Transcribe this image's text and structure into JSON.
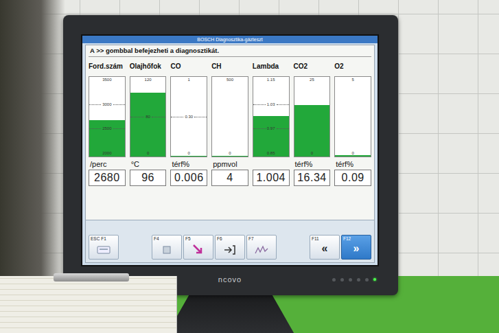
{
  "monitor": {
    "brand": "ncovo",
    "power_on": true
  },
  "screen": {
    "title": "BOSCH Diagnosztika-gázteszt",
    "message": "A >> gombbal befejezheti a diagnosztikát."
  },
  "gauges": [
    {
      "label": "Ford.szám",
      "ticks": [
        "3500",
        "3000",
        "2500",
        "2000"
      ],
      "level": 0.46,
      "unit": "/perc",
      "reading": "2680"
    },
    {
      "label": "Olajhőfok",
      "ticks": [
        "120",
        "80",
        "0"
      ],
      "level": 0.8,
      "unit": "°C",
      "reading": "96"
    },
    {
      "label": "CO",
      "ticks": [
        "1",
        "0.30",
        "0"
      ],
      "level": 0.006,
      "unit": "térf%",
      "reading": "0.006"
    },
    {
      "label": "CH",
      "ticks": [
        "500",
        "0"
      ],
      "level": 0.008,
      "unit": "ppmvol",
      "reading": "4"
    },
    {
      "label": "Lambda",
      "ticks": [
        "1.15",
        "1.03",
        "0.97",
        "0.85"
      ],
      "level": 0.51,
      "reading": "1.004"
    },
    {
      "label": "CO2",
      "ticks": [
        "25",
        "0"
      ],
      "level": 0.65,
      "unit": "térf%",
      "reading": "16.34"
    },
    {
      "label": "O2",
      "ticks": [
        "5",
        "0"
      ],
      "level": 0.018,
      "unit": "térf%",
      "reading": "0.09"
    }
  ],
  "function_keys": [
    [
      {
        "label": "ESC F1",
        "selected": false
      }
    ],
    [
      {
        "label": "F4",
        "selected": false
      },
      {
        "label": "F5",
        "selected": false
      },
      {
        "label": "F6",
        "selected": false
      },
      {
        "label": "F7",
        "selected": false
      }
    ],
    [
      {
        "label": "F11",
        "glyph": "«",
        "selected": false
      },
      {
        "label": "F12",
        "glyph": "»",
        "selected": true
      }
    ]
  ]
}
